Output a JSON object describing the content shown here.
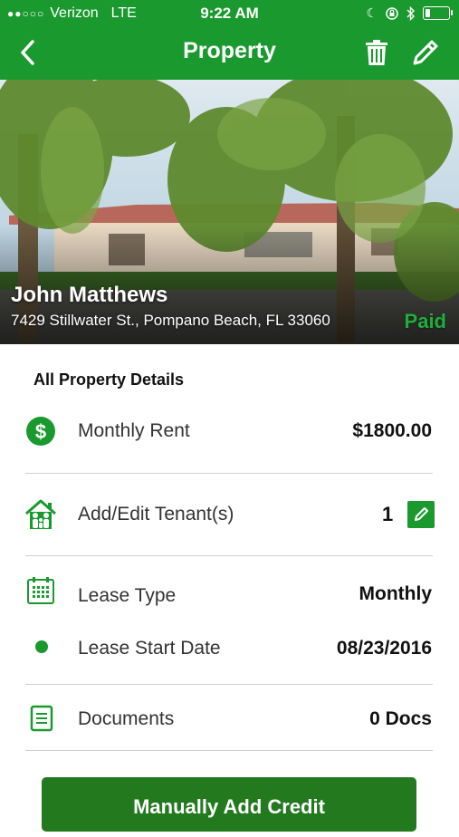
{
  "status_bar": {
    "carrier": "Verizon",
    "network": "LTE",
    "time": "9:22 AM"
  },
  "nav": {
    "title": "Property"
  },
  "property": {
    "owner_name": "John Matthews",
    "address": "7429 Stillwater St., Pompano Beach, FL 33060",
    "payment_status": "Paid"
  },
  "details": {
    "section_title": "All Property Details",
    "monthly_rent_label": "Monthly Rent",
    "monthly_rent_value": "$1800.00",
    "tenants_label": "Add/Edit Tenant(s)",
    "tenants_count": "1",
    "lease_type_label": "Lease Type",
    "lease_type_value": "Monthly",
    "lease_start_label": "Lease Start Date",
    "lease_start_value": "08/23/2016",
    "documents_label": "Documents",
    "documents_value": "0 Docs"
  },
  "actions": {
    "manual_credit_label": "Manually Add Credit"
  },
  "colors": {
    "brand_green": "#1a9a2e",
    "button_green": "#237a1e",
    "paid_green": "#1fae3a"
  },
  "icons": [
    "back-chevron-icon",
    "trash-icon",
    "pencil-icon",
    "dollar-icon",
    "house-family-icon",
    "calendar-icon",
    "dot-icon",
    "document-icon"
  ]
}
